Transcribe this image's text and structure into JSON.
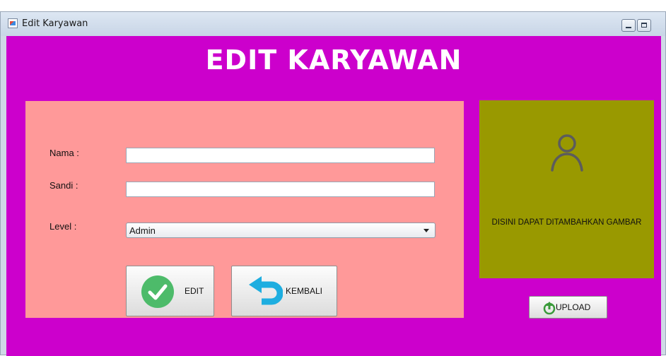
{
  "window": {
    "title": "Edit Karyawan"
  },
  "page": {
    "heading": "EDIT KARYAWAN"
  },
  "form": {
    "nama_label": "Nama :",
    "nama_value": "",
    "sandi_label": "Sandi :",
    "sandi_value": "",
    "level_label": "Level :",
    "level_selected": "Admin",
    "edit_label": "EDIT",
    "kembali_label": "KEMBALI"
  },
  "image_panel": {
    "caption": "DISINI DAPAT DITAMBAHKAN GAMBAR",
    "upload_label": "UPLOAD"
  },
  "icons": [
    "app-icon",
    "minimize-icon",
    "maximize-icon",
    "check-icon",
    "back-arrow-icon",
    "user-icon",
    "upload-icon",
    "chevron-down-icon"
  ],
  "colors": {
    "background": "#cc00cc",
    "form_panel": "#ff9999",
    "image_panel": "#999900",
    "edit_icon": "#4dbb6a",
    "back_icon": "#1eaee0",
    "heading_text": "#ffffff"
  }
}
